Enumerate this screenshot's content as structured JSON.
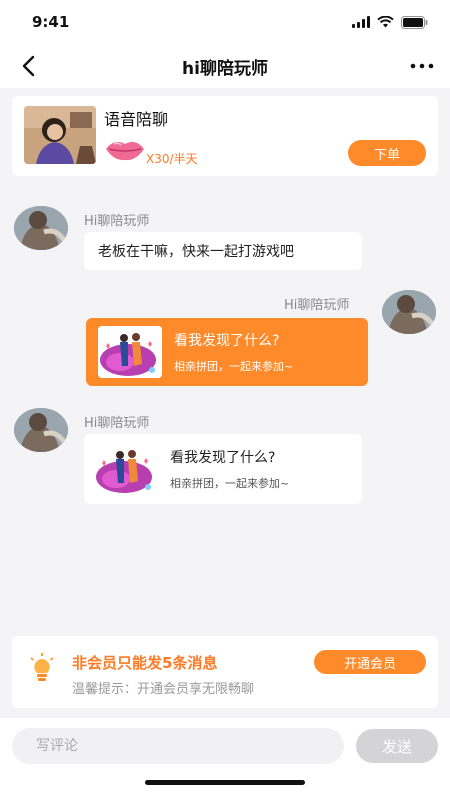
{
  "status_bar": {
    "time": "9:41"
  },
  "nav": {
    "title": "hi聊陪玩师"
  },
  "service": {
    "title": "语音陪聊",
    "price": "X30/半天",
    "order_label": "下单"
  },
  "chat": {
    "messages": [
      {
        "sender": "Hi聊陪玩师",
        "text": "老板在干嘛，快来一起打游戏吧"
      },
      {
        "sender": "Hi聊陪玩师",
        "card_title": "看我发现了什么?",
        "card_subtitle": "相亲拼团，一起来参加~"
      },
      {
        "sender": "Hi聊陪玩师",
        "card_title": "看我发现了什么?",
        "card_subtitle": "相亲拼团，一起来参加~"
      }
    ]
  },
  "member": {
    "title": "非会员只能发5条消息",
    "tip": "温馨提示：开通会员享无限畅聊",
    "open_label": "开通会员"
  },
  "input": {
    "placeholder": "写评论",
    "send_label": "发送"
  },
  "colors": {
    "accent": "#ff8a2a",
    "accent_text": "#ff7a24",
    "background": "#f4f4f6"
  }
}
